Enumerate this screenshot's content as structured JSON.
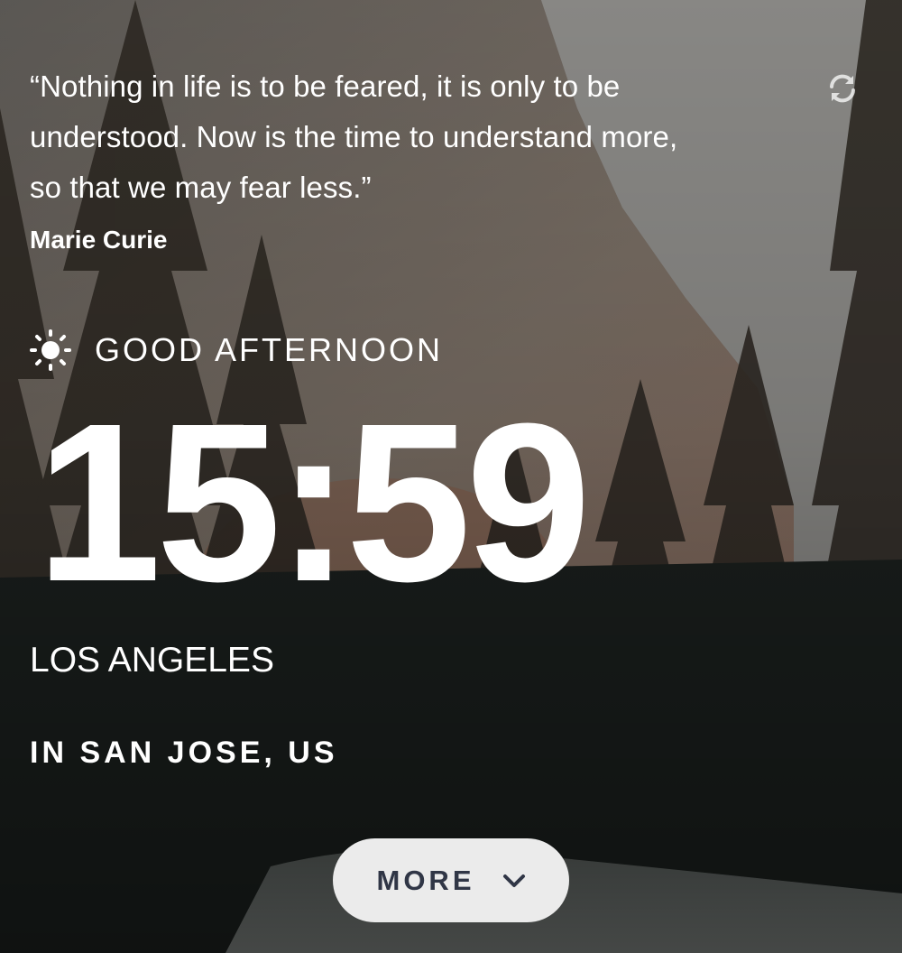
{
  "quote": {
    "text": "“Nothing in life is to be feared, it is only to be understood. Now is the time to understand more, so that we may fear less.”",
    "author": "Marie Curie"
  },
  "refresh_icon": "refresh-icon",
  "greeting": {
    "icon": "sun-icon",
    "text": "GOOD AFTERNOON"
  },
  "clock": {
    "time": "15:59"
  },
  "timezone_city": "LOS ANGELES",
  "location_text": "IN SAN JOSE, US",
  "more_button": {
    "label": "MORE",
    "icon": "chevron-down-icon",
    "background": "#ebebeb",
    "text_color": "#303646"
  }
}
